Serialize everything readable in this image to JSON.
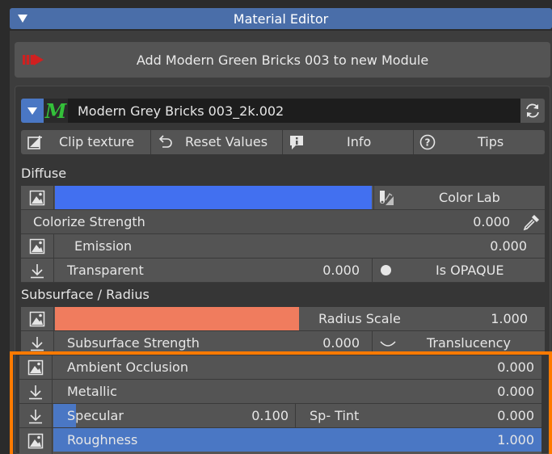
{
  "panel": {
    "title": "Material Editor"
  },
  "add_button": {
    "label": "Add Modern Green Bricks 003 to new Module"
  },
  "material": {
    "name": "Modern Grey Bricks 003_2k.002",
    "logo_text": "M"
  },
  "toolbar": {
    "clip_label": "Clip texture",
    "reset_label": "Reset Values",
    "info_label": "Info",
    "tips_label": "Tips"
  },
  "diffuse": {
    "section_label": "Diffuse",
    "color": "#4270f0",
    "color_lab_label": "Color Lab",
    "colorize_label": "Colorize Strength",
    "colorize_value": "0.000",
    "emission_label": "Emission",
    "emission_value": "0.000",
    "transparent_label": "Transparent",
    "transparent_value": "0.000",
    "opaque_label": "Is OPAQUE"
  },
  "subsurface": {
    "section_label": "Subsurface / Radius",
    "color": "#f07c5e",
    "radius_scale_label": "Radius Scale",
    "radius_scale_value": "1.000",
    "strength_label": "Subsurface Strength",
    "strength_value": "0.000",
    "translucency_label": "Translucency"
  },
  "surface": {
    "ao_label": "Ambient Occlusion",
    "ao_value": "0.000",
    "metallic_label": "Metallic",
    "metallic_value": "0.000",
    "specular_label": "Specular",
    "specular_value": "0.100",
    "specular_fill": 0.1,
    "sp_tint_label": "Sp- Tint",
    "sp_tint_value": "0.000",
    "roughness_label": "Roughness",
    "roughness_value": "1.000",
    "roughness_fill": 1.0
  },
  "colors": {
    "accent": "#4a77c4",
    "highlight": "#ff7a00"
  }
}
